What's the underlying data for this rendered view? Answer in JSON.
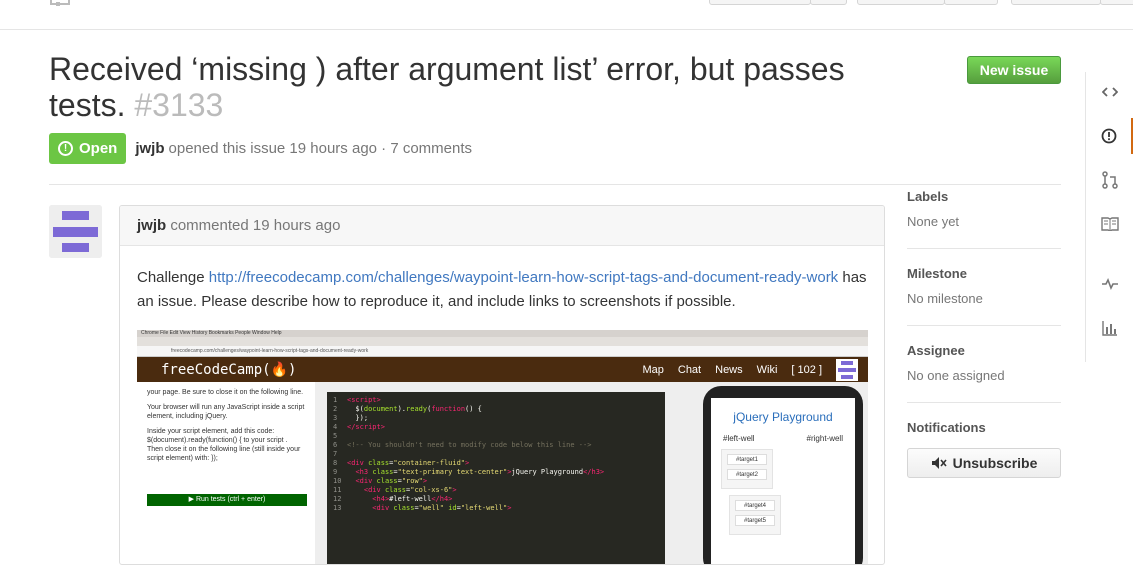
{
  "issue": {
    "title": "Received ‘missing ) after argument list’ error, but passes tests.",
    "number": "#3133",
    "state": "Open",
    "author": "jwjb",
    "opened_text": "opened this issue 19 hours ago · 7 comments",
    "new_issue_label": "New issue"
  },
  "comment": {
    "author": "jwjb",
    "time_text": "commented 19 hours ago",
    "lead": "Challenge",
    "link": "http://freecodecamp.com/challenges/waypoint-learn-how-script-tags-and-document-ready-work",
    "rest": "has an issue. Please describe how to reproduce it, and include links to screenshots if possible."
  },
  "screenshot": {
    "os_menu": "Chrome   File   Edit   View   History   Bookmarks   People   Window   Help",
    "url": "freecodecamp.com/challenges/waypoint-learn-how-script-tags-and-document-ready-work",
    "brand": "freeCodeCamp(🔥)",
    "nav": [
      "Map",
      "Chat",
      "News",
      "Wiki",
      "[ 102 ]"
    ],
    "left_p1": "your page. Be sure to close it on the following line.",
    "left_p2": "Your browser will run any JavaScript inside a script element, including jQuery.",
    "left_p3": "Inside your script element, add this code: $(document).ready(function() { to your script . Then close it on the following line (still inside your script element) with: });",
    "run_label": "▶ Run tests (ctrl + enter)",
    "playground_title": "jQuery Playground",
    "left_well": "#left-well",
    "right_well": "#right-well",
    "targets": [
      "#target1",
      "#target2",
      "#target4",
      "#target5"
    ]
  },
  "sidebar": {
    "labels_title": "Labels",
    "labels_value": "None yet",
    "milestone_title": "Milestone",
    "milestone_value": "No milestone",
    "assignee_title": "Assignee",
    "assignee_value": "No one assigned",
    "notifications_title": "Notifications",
    "unsubscribe_label": "Unsubscribe"
  },
  "rail_icons": [
    "code-icon",
    "issue-opened-icon",
    "pull-request-icon",
    "book-icon",
    "pulse-icon",
    "graph-icon"
  ],
  "colors": {
    "open_green": "#6cc644",
    "link_blue": "#4078c0",
    "rail_selected": "#d26911"
  }
}
